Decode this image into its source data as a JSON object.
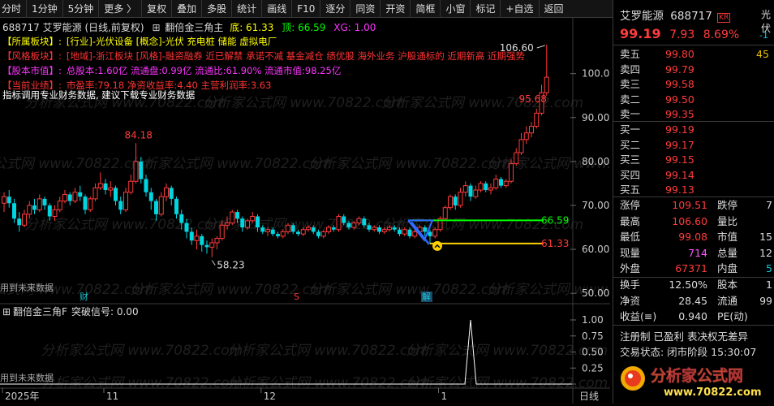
{
  "toolbar": {
    "items": [
      {
        "name": "fenshi",
        "label": "分时"
      },
      {
        "name": "1min",
        "label": "1分钟"
      },
      {
        "name": "5min",
        "label": "5分钟"
      },
      {
        "name": "more",
        "label": "更多 〉"
      },
      {
        "name": "fuquan",
        "label": "复权"
      },
      {
        "name": "diejia",
        "label": "叠加"
      },
      {
        "name": "duogu",
        "label": "多股"
      },
      {
        "name": "tongji",
        "label": "统计"
      },
      {
        "name": "huaxian",
        "label": "画线"
      },
      {
        "name": "f10",
        "label": "F10"
      },
      {
        "name": "zhubi",
        "label": "逐分"
      },
      {
        "name": "tongzi",
        "label": "同资"
      },
      {
        "name": "kaizi",
        "label": "开资"
      },
      {
        "name": "jianzheng",
        "label": "简框"
      },
      {
        "name": "xiaochuang",
        "label": "小窗"
      },
      {
        "name": "biaoji",
        "label": "标记"
      },
      {
        "name": "zixuan",
        "label": "+自选"
      },
      {
        "name": "fanhui",
        "label": "返回"
      }
    ]
  },
  "chart_header": {
    "code_title": "688717 艾罗能源 (日线,前复权)",
    "indicator": "翻倍金三角主",
    "di_label": "底: 61.33",
    "ding_label": "顶: 66.59",
    "xg_label": "XG: 1.00"
  },
  "info_lines": [
    {
      "prefix": "【所属板块】:",
      "text": "[行业]-光伏设备 [概念]-光伏 充电桩 储能 虚拟电厂",
      "color": "#ffff00"
    },
    {
      "prefix": "【风格板块】:",
      "text": "[地域]-浙江板块 [风格]-融资融券 近已解禁 承诺不减 基金减仓 绩优股 海外业务 沪股通标的 近期新高 近期强势",
      "color": "#ff3333"
    },
    {
      "prefix": "【股本市值】:",
      "text": "总股本:1.60亿 流通盘:0.99亿 流通比:61.90% 流通市值:98.25亿",
      "color": "#ff33ff"
    },
    {
      "prefix": "【当前业绩】:",
      "text": "市盈率:79.18 净资收益率:4.40 主营利润率:3.63",
      "color": "#ff3333"
    }
  ],
  "notice": "指标调用专业财务数据, 建议下载专业财务数据",
  "future_data_1": "用到未来数据",
  "future_data_2": "用到未来数据",
  "watermark": "分析家公式网 www.70822.com",
  "markers": {
    "cai": "财",
    "s": "S",
    "jie": "解"
  },
  "sub_header": {
    "title": "翻倍金三角F",
    "signal": "突破信号: 0.00"
  },
  "chart_data": {
    "type": "candlestick",
    "y_ticks": [
      50.0,
      60.0,
      70.0,
      80.0,
      90.0,
      100.0
    ],
    "ylim": [
      48.0,
      109.0
    ],
    "sub_y_ticks": [
      0.0,
      0.25,
      0.5,
      0.75,
      1.0
    ],
    "x_labels": [
      {
        "label": "2025年",
        "index": 0
      },
      {
        "label": "11",
        "index": 20
      },
      {
        "label": "12",
        "index": 51
      },
      {
        "label": "1",
        "index": 86
      }
    ],
    "period_label": "日线",
    "annotations": [
      {
        "text": "84.18",
        "value": 84.18,
        "index": 26
      },
      {
        "text": "58.23",
        "value": 58.23,
        "index": 41
      },
      {
        "text": "106.60",
        "value": 106.6,
        "index": 107
      },
      {
        "text": "95.68",
        "value": 95.68,
        "index": 106
      },
      {
        "text": "66.59",
        "value": 66.59
      },
      {
        "text": "61.33",
        "value": 61.33
      }
    ],
    "green_line": {
      "value": 66.59,
      "start_index": 80
    },
    "yellow_line": {
      "value": 61.33,
      "start_index": 84
    },
    "candles": [
      [
        70.5,
        72.0,
        73.0,
        68.5
      ],
      [
        72.0,
        70.5,
        73.5,
        69.5
      ],
      [
        70.5,
        67.0,
        71.5,
        66.0
      ],
      [
        67.0,
        65.5,
        68.5,
        64.0
      ],
      [
        65.5,
        68.0,
        69.0,
        65.0
      ],
      [
        68.0,
        70.0,
        71.0,
        67.0
      ],
      [
        70.0,
        69.0,
        71.5,
        68.0
      ],
      [
        69.0,
        71.5,
        72.5,
        68.5
      ],
      [
        71.5,
        70.0,
        72.0,
        69.0
      ],
      [
        70.0,
        67.5,
        70.5,
        66.5
      ],
      [
        67.5,
        69.0,
        70.0,
        66.5
      ],
      [
        69.0,
        71.0,
        72.0,
        68.5
      ],
      [
        71.0,
        72.5,
        73.5,
        70.5
      ],
      [
        72.5,
        71.0,
        73.0,
        70.0
      ],
      [
        71.0,
        73.0,
        74.0,
        70.5
      ],
      [
        73.0,
        72.0,
        74.5,
        71.0
      ],
      [
        72.0,
        69.0,
        72.5,
        68.0
      ],
      [
        69.0,
        71.5,
        72.0,
        68.5
      ],
      [
        71.5,
        74.0,
        75.0,
        71.0
      ],
      [
        74.0,
        75.0,
        77.5,
        73.5
      ],
      [
        75.0,
        73.5,
        76.0,
        72.5
      ],
      [
        73.5,
        74.0,
        75.5,
        72.0
      ],
      [
        74.0,
        71.0,
        74.5,
        70.0
      ],
      [
        71.0,
        69.0,
        72.0,
        68.0
      ],
      [
        69.0,
        73.0,
        74.0,
        68.5
      ],
      [
        73.0,
        75.5,
        77.0,
        72.5
      ],
      [
        75.5,
        80.0,
        84.18,
        75.0
      ],
      [
        80.0,
        76.0,
        81.0,
        75.0
      ],
      [
        76.0,
        73.0,
        77.0,
        72.0
      ],
      [
        73.0,
        71.0,
        74.0,
        69.0
      ],
      [
        71.0,
        68.0,
        71.5,
        66.5
      ],
      [
        68.0,
        72.0,
        73.0,
        67.5
      ],
      [
        72.0,
        74.0,
        75.0,
        71.0
      ],
      [
        74.0,
        71.5,
        74.5,
        70.0
      ],
      [
        71.5,
        68.0,
        72.0,
        67.0
      ],
      [
        68.0,
        66.0,
        69.0,
        64.5
      ],
      [
        66.0,
        64.0,
        67.0,
        62.5
      ],
      [
        64.0,
        62.0,
        65.0,
        61.0
      ],
      [
        62.0,
        63.0,
        64.5,
        60.0
      ],
      [
        63.0,
        61.0,
        63.5,
        59.5
      ],
      [
        61.0,
        60.5,
        62.0,
        59.0
      ],
      [
        60.5,
        61.5,
        62.5,
        58.23
      ],
      [
        61.5,
        62.5,
        63.0,
        60.0
      ],
      [
        62.5,
        65.5,
        66.5,
        62.0
      ],
      [
        65.5,
        66.0,
        67.5,
        64.5
      ],
      [
        66.0,
        68.5,
        69.0,
        65.5
      ],
      [
        68.5,
        67.0,
        69.0,
        66.0
      ],
      [
        67.0,
        65.0,
        67.5,
        64.0
      ],
      [
        65.0,
        66.5,
        67.0,
        64.5
      ],
      [
        66.5,
        67.5,
        68.5,
        66.0
      ],
      [
        67.5,
        65.0,
        68.0,
        64.0
      ],
      [
        65.0,
        64.0,
        65.5,
        63.5
      ],
      [
        64.0,
        64.5,
        65.0,
        63.0
      ],
      [
        64.5,
        63.5,
        65.0,
        63.0
      ],
      [
        63.5,
        63.0,
        64.0,
        62.5
      ],
      [
        63.0,
        64.0,
        64.5,
        62.5
      ],
      [
        64.0,
        65.5,
        66.0,
        63.5
      ],
      [
        65.5,
        64.0,
        66.0,
        63.5
      ],
      [
        64.0,
        63.5,
        64.5,
        63.0
      ],
      [
        63.5,
        64.5,
        65.0,
        63.0
      ],
      [
        64.5,
        65.0,
        65.5,
        64.0
      ],
      [
        65.0,
        64.0,
        65.5,
        63.5
      ],
      [
        64.0,
        63.0,
        64.5,
        62.5
      ],
      [
        63.0,
        64.0,
        64.5,
        62.5
      ],
      [
        64.0,
        65.0,
        65.5,
        63.5
      ],
      [
        65.0,
        64.5,
        65.5,
        64.0
      ],
      [
        64.5,
        67.5,
        68.0,
        64.0
      ],
      [
        67.5,
        66.0,
        68.0,
        65.5
      ],
      [
        66.0,
        65.0,
        66.5,
        64.5
      ],
      [
        65.0,
        66.0,
        66.5,
        64.5
      ],
      [
        66.0,
        67.0,
        67.5,
        65.5
      ],
      [
        67.0,
        65.5,
        67.5,
        65.0
      ],
      [
        65.5,
        64.5,
        66.0,
        64.0
      ],
      [
        64.5,
        65.0,
        65.5,
        64.0
      ],
      [
        65.0,
        64.0,
        65.5,
        63.5
      ],
      [
        64.0,
        64.5,
        65.0,
        63.5
      ],
      [
        64.5,
        65.0,
        65.5,
        64.0
      ],
      [
        65.0,
        64.5,
        65.5,
        64.0
      ],
      [
        64.5,
        63.5,
        65.0,
        63.0
      ],
      [
        63.5,
        64.5,
        65.0,
        63.0
      ],
      [
        64.5,
        63.0,
        65.0,
        62.5
      ],
      [
        63.0,
        64.0,
        64.5,
        62.5
      ],
      [
        64.0,
        65.0,
        65.5,
        63.5
      ],
      [
        65.0,
        64.0,
        65.5,
        63.0
      ],
      [
        64.0,
        63.0,
        64.5,
        61.33
      ],
      [
        63.0,
        64.5,
        65.0,
        62.5
      ],
      [
        64.5,
        67.0,
        67.5,
        64.0
      ],
      [
        67.0,
        69.5,
        70.0,
        66.5
      ],
      [
        69.5,
        72.0,
        72.5,
        69.0
      ],
      [
        72.0,
        70.0,
        72.5,
        69.0
      ],
      [
        70.0,
        73.0,
        74.0,
        69.5
      ],
      [
        73.0,
        74.5,
        75.5,
        72.0
      ],
      [
        74.5,
        72.0,
        75.0,
        71.0
      ],
      [
        72.0,
        73.5,
        74.5,
        71.5
      ],
      [
        73.5,
        75.0,
        75.5,
        73.0
      ],
      [
        75.0,
        73.5,
        75.5,
        73.0
      ],
      [
        73.5,
        74.0,
        75.0,
        72.5
      ],
      [
        74.0,
        76.0,
        77.0,
        73.5
      ],
      [
        76.0,
        74.5,
        76.5,
        74.0
      ],
      [
        74.5,
        75.5,
        76.0,
        74.0
      ],
      [
        75.5,
        79.5,
        80.5,
        75.0
      ],
      [
        79.5,
        82.0,
        83.0,
        79.0
      ],
      [
        82.0,
        85.0,
        86.5,
        81.5
      ],
      [
        85.0,
        86.5,
        88.0,
        84.0
      ],
      [
        86.5,
        88.0,
        89.0,
        85.5
      ],
      [
        88.0,
        91.0,
        92.0,
        87.5
      ],
      [
        91.0,
        95.68,
        97.5,
        90.5
      ],
      [
        95.68,
        99.19,
        106.6,
        95.0
      ]
    ],
    "signal_peak_index": 92,
    "signal_peak_value": 1.0
  },
  "quote": {
    "name": "艾罗能源",
    "code": "688717",
    "kr_badge": "KR",
    "extra": "光伏",
    "price": "99.19",
    "change": "7.93",
    "pct": "8.69%",
    "asks": [
      {
        "label": "卖五",
        "price": "99.80",
        "vol": "45"
      },
      {
        "label": "卖四",
        "price": "99.79",
        "vol": ""
      },
      {
        "label": "卖三",
        "price": "99.58",
        "vol": ""
      },
      {
        "label": "卖二",
        "price": "99.50",
        "vol": ""
      },
      {
        "label": "卖一",
        "price": "99.35",
        "vol": ""
      }
    ],
    "bids": [
      {
        "label": "买一",
        "price": "99.19",
        "vol": ""
      },
      {
        "label": "买二",
        "price": "99.17",
        "vol": ""
      },
      {
        "label": "买三",
        "price": "99.15",
        "vol": ""
      },
      {
        "label": "买四",
        "price": "99.14",
        "vol": ""
      },
      {
        "label": "买五",
        "price": "99.13",
        "vol": ""
      }
    ],
    "stats": [
      {
        "l1": "涨停",
        "v1": "109.51",
        "c1": "#ff3b3b",
        "l2": "跌停",
        "v2": "7",
        "c2": "#ddd"
      },
      {
        "l1": "最高",
        "v1": "106.60",
        "c1": "#ff3b3b",
        "l2": "量比",
        "v2": "",
        "c2": "#ddd"
      },
      {
        "l1": "最低",
        "v1": "99.08",
        "c1": "#ff3b3b",
        "l2": "市值",
        "v2": "15",
        "c2": "#ddd"
      },
      {
        "l1": "现量",
        "v1": "714",
        "c1": "#ff55ff",
        "l2": "总量",
        "v2": "12",
        "c2": "#ddd"
      },
      {
        "l1": "外盘",
        "v1": "67371",
        "c1": "#ff3b3b",
        "l2": "内盘",
        "v2": "5",
        "c2": "#19c7d6"
      }
    ],
    "stats2": [
      {
        "l1": "换手",
        "v1": "12.50%",
        "c1": "#ddd",
        "l2": "股本",
        "v2": "1",
        "c2": "#ddd"
      },
      {
        "l1": "净资",
        "v1": "28.45",
        "c1": "#ddd",
        "l2": "流通",
        "v2": "99",
        "c2": "#ddd"
      },
      {
        "l1": "收益(≡)",
        "v1": "0.940",
        "c1": "#ddd",
        "l2": "PE(动)",
        "v2": "",
        "c2": "#ddd"
      }
    ],
    "reg": "注册制 已盈利 表决权无差异",
    "trade_status": "交易状态: 闭市阶段 15:30:07"
  },
  "logo": {
    "text": "分析家公式网",
    "url": "www.70822.com"
  }
}
